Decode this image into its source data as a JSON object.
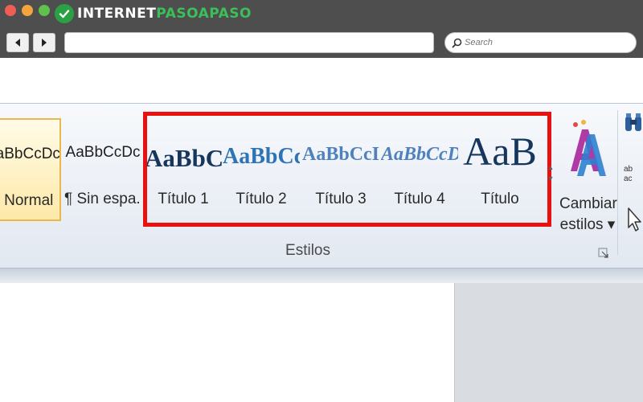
{
  "browser": {
    "logo_part1": "INTERNET",
    "logo_part2": "PASOAPASO",
    "back_icon": "back-arrow-icon",
    "forward_icon": "forward-arrow-icon",
    "url_value": "",
    "search_placeholder": "Search",
    "search_icon": "magnifier-icon"
  },
  "ribbon": {
    "group_label": "Estilos",
    "styles": [
      {
        "preview": "AaBbCcDc",
        "label": "¶ Normal",
        "selected": true
      },
      {
        "preview": "AaBbCcDc",
        "label": "¶ Sin espa...",
        "selected": false
      },
      {
        "preview": "AaBbCc",
        "label": "Título 1",
        "selected": false
      },
      {
        "preview": "AaBbCc",
        "label": "Título 2",
        "selected": false
      },
      {
        "preview": "AaBbCcI",
        "label": "Título 3",
        "selected": false
      },
      {
        "preview": "AaBbCcD",
        "label": "Título 4",
        "selected": false
      },
      {
        "preview": "AaB",
        "label": "Título",
        "selected": false
      }
    ],
    "change_styles": {
      "line1": "Cambiar",
      "line2": "estilos ▾"
    },
    "edit_tools": {
      "replace_text": "ab\nac"
    }
  },
  "colors": {
    "highlight": "#ea1010",
    "selected_style": "#e9b74b",
    "heading_dark": "#17365d",
    "heading_blue": "#2e74b5",
    "logo_green": "#3cbe5a"
  }
}
